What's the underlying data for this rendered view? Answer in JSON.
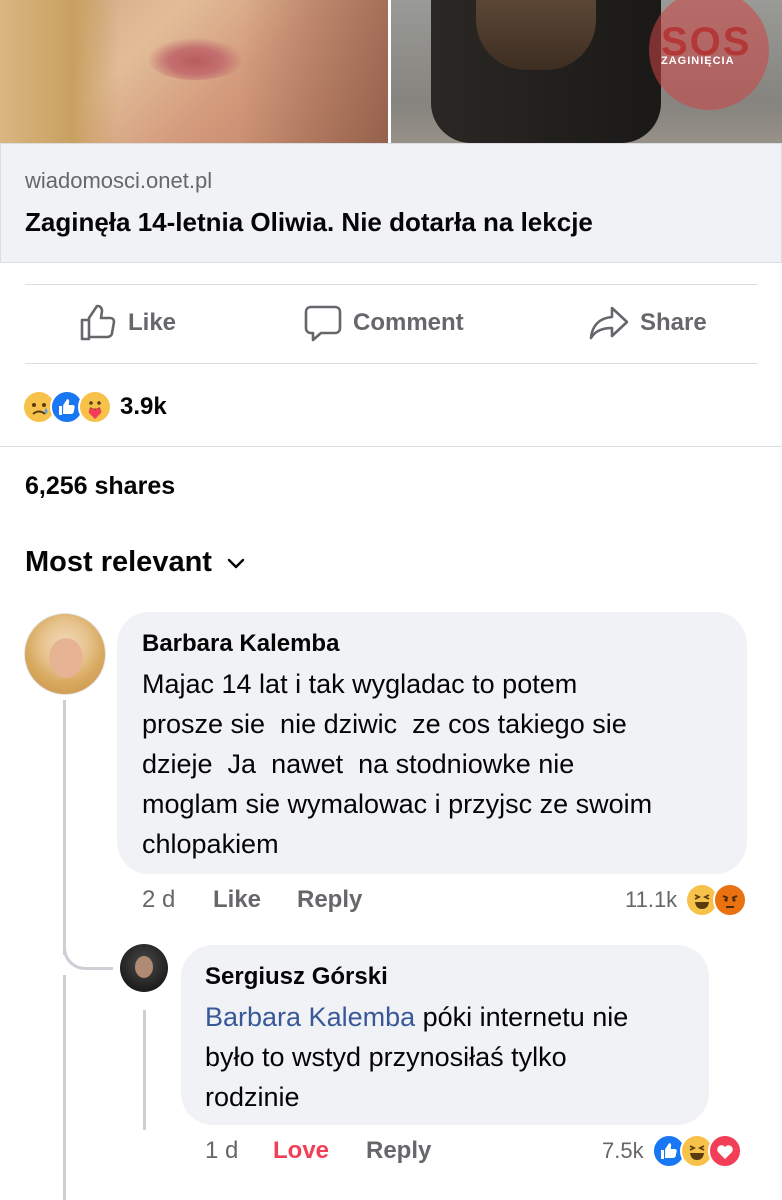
{
  "image_watermark": {
    "main": "SOS",
    "sub": "ZAGINIĘCIA"
  },
  "link": {
    "domain": "wiadomosci.onet.pl",
    "title": "Zaginęła 14-letnia Oliwia. Nie dotarła na lekcje"
  },
  "actions": {
    "like": "Like",
    "comment": "Comment",
    "share": "Share"
  },
  "post": {
    "reaction_icons": [
      "sad-icon",
      "like-icon",
      "care-icon"
    ],
    "reaction_count": "3.9k",
    "shares": "6,256 shares",
    "sort_label": "Most relevant"
  },
  "comments": [
    {
      "author": "Barbara Kalemba",
      "text_lines": [
        "Majac 14 lat i tak wygladac to potem",
        "prosze sie  nie dziwic  ze cos takiego sie",
        "dzieje  Ja  nawet  na stodniowke nie",
        "moglam sie wymalowac i przyjsc ze swoim",
        "chlopakiem"
      ],
      "time": "2 d",
      "like_label": "Like",
      "reply_label": "Reply",
      "reaction_count": "11.1k",
      "reaction_icons": [
        "haha-icon",
        "angry-icon"
      ]
    },
    {
      "author": "Sergiusz Górski",
      "mention": "Barbara Kalemba",
      "text_first": " póki internetu nie",
      "text_lines": [
        "było to wstyd przynosiłaś tylko",
        "rodzinie"
      ],
      "time": "1 d",
      "like_label": "Love",
      "reply_label": "Reply",
      "reaction_count": "7.5k",
      "reaction_icons": [
        "like-icon",
        "haha-icon",
        "love-icon"
      ]
    }
  ],
  "colors": {
    "accent": "#1877f2",
    "love": "#f33e58",
    "mention": "#385898",
    "bubble": "#f0f2f5",
    "muted": "#65676b"
  }
}
